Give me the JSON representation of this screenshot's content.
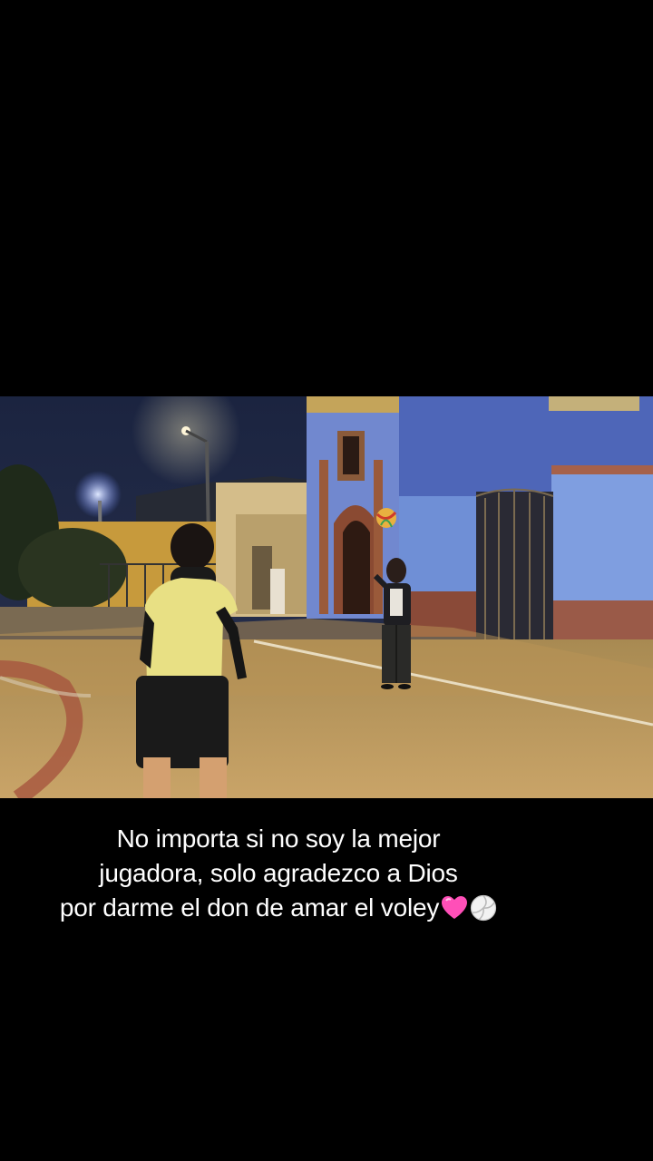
{
  "caption": {
    "line1": "No importa si no soy la mejor",
    "line2": "jugadora, solo agradezco a Dios",
    "line3": "por darme el don de amar el voley",
    "emojis": [
      "pink-heart-icon",
      "volleyball-icon"
    ]
  },
  "colors": {
    "background": "#000000",
    "caption_text": "#ffffff",
    "wall_blue": "#6f8fd6",
    "street_light": "#f0c060"
  }
}
